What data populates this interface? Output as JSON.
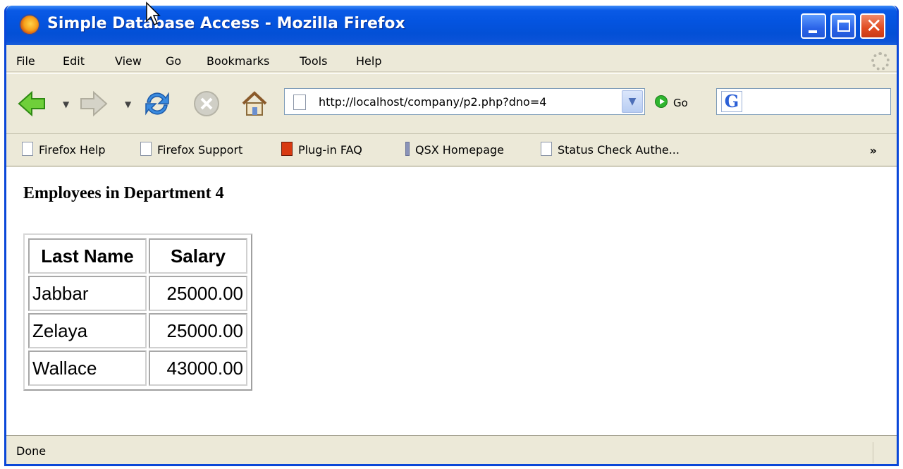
{
  "window": {
    "title": "Simple Database Access - Mozilla Firefox"
  },
  "menubar": {
    "items": [
      "File",
      "Edit",
      "View",
      "Go",
      "Bookmarks",
      "Tools",
      "Help"
    ]
  },
  "toolbar": {
    "url": "http://localhost/company/p2.php?dno=4",
    "go_label": "Go",
    "search_value": ""
  },
  "bookmarks": [
    {
      "label": "Firefox Help",
      "icon": "page-icon"
    },
    {
      "label": "Firefox Support",
      "icon": "page-icon"
    },
    {
      "label": "Plug-in FAQ",
      "icon": "plugin-icon"
    },
    {
      "label": "QSX Homepage",
      "icon": "info-icon"
    },
    {
      "label": "Status Check Authe...",
      "icon": "page-icon"
    }
  ],
  "page": {
    "heading": "Employees in Department 4",
    "table": {
      "headers": [
        "Last Name",
        "Salary"
      ],
      "rows": [
        [
          "Jabbar",
          "25000.00"
        ],
        [
          "Zelaya",
          "25000.00"
        ],
        [
          "Wallace",
          "43000.00"
        ]
      ]
    }
  },
  "status": {
    "text": "Done"
  },
  "colors": {
    "titlebar": "#0454e0",
    "chrome": "#ece9d8",
    "close_button": "#e04b20"
  }
}
